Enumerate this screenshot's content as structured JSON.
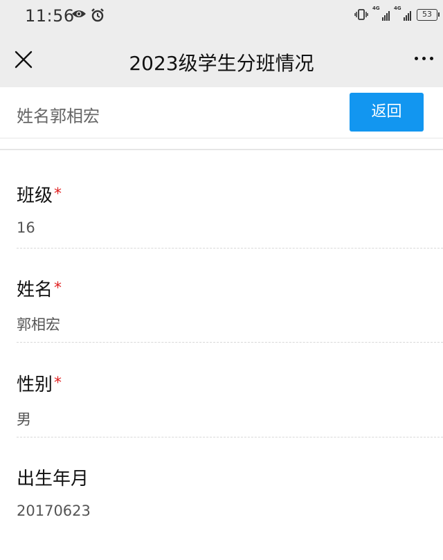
{
  "status_bar": {
    "time": "11:56",
    "signal1_tag": "4G",
    "signal2_tag": "4G",
    "battery": "53",
    "icons": [
      "eye-icon",
      "alarm-icon",
      "vibrate-icon",
      "signal-icon",
      "signal-icon",
      "battery-icon"
    ]
  },
  "nav": {
    "title": "2023级学生分班情况",
    "close_icon": "close-icon",
    "more_icon": "more-icon"
  },
  "search": {
    "text": "姓名郭相宏",
    "back_label": "返回"
  },
  "colors": {
    "accent": "#1296f0",
    "required": "#e02020",
    "nav_bg": "#ededed"
  },
  "fields": [
    {
      "label": "班级",
      "required": "*",
      "value": "16"
    },
    {
      "label": "姓名",
      "required": "*",
      "value": "郭相宏"
    },
    {
      "label": "性别",
      "required": "*",
      "value": "男"
    },
    {
      "label": "出生年月",
      "required": "",
      "value": "20170623"
    }
  ]
}
